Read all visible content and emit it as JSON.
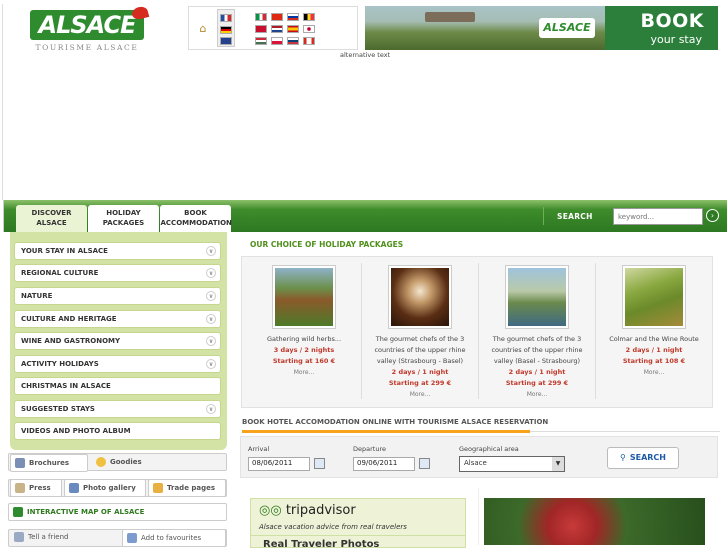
{
  "logo": {
    "brand": "ALSACE",
    "tagline": "TOURISME ALSACE"
  },
  "banner": {
    "alt": "alternative text",
    "chip": "ALSACE",
    "book": "BOOK",
    "sub": "your stay"
  },
  "tabs": [
    {
      "label": "DISCOVER ALSACE"
    },
    {
      "label": "HOLIDAY PACKAGES"
    },
    {
      "label": "BOOK ACCOMMODATION"
    }
  ],
  "search": {
    "label": "SEARCH",
    "placeholder": "keyword..."
  },
  "menu": [
    {
      "label": "YOUR STAY IN ALSACE"
    },
    {
      "label": "REGIONAL CULTURE"
    },
    {
      "label": "NATURE"
    },
    {
      "label": "CULTURE AND HERITAGE"
    },
    {
      "label": "WINE AND GASTRONOMY"
    },
    {
      "label": "ACTIVITY HOLIDAYS"
    },
    {
      "label": "CHRISTMAS IN ALSACE"
    },
    {
      "label": "SUGGESTED STAYS"
    },
    {
      "label": "VIDEOS AND PHOTO ALBUM"
    }
  ],
  "quicklinks": {
    "brochures": "Brochures",
    "goodies": "Goodies",
    "press": "Press",
    "gallery": "Photo gallery",
    "trade": "Trade pages",
    "map": "INTERACTIVE MAP OF ALSACE",
    "friend": "Tell a friend",
    "fav": "Add to favourites"
  },
  "packages": {
    "title": "OUR CHOICE OF HOLIDAY PACKAGES",
    "items": [
      {
        "name": "Gathering wild herbs...",
        "duration": "3 days / 2 nights",
        "price": "Starting at 160 €",
        "more": "More..."
      },
      {
        "name": "The gourmet chefs of the 3 countries of the upper rhine valley (Strasbourg - Basel)",
        "duration": "2 days / 1 night",
        "price": "Starting at 299 €",
        "more": "More..."
      },
      {
        "name": "The gourmet chefs of the 3 countries of the upper rhine valley (Basel - Strasbourg)",
        "duration": "2 days / 1 night",
        "price": "Starting at 299 €",
        "more": "More..."
      },
      {
        "name": "Colmar and the Wine Route",
        "duration": "2 days / 1 night",
        "price": "Starting at 108 €",
        "more": "More..."
      }
    ]
  },
  "booking": {
    "title": "BOOK HOTEL ACCOMODATION ONLINE WITH TOURISME ALSACE RESERVATION",
    "arrival_label": "Arrival",
    "arrival_value": "08/06/2011",
    "departure_label": "Departure",
    "departure_value": "09/06/2011",
    "geo_label": "Geographical area",
    "geo_value": "Alsace",
    "search_label": "SEARCH"
  },
  "tripadvisor": {
    "logo": "tripadvisor",
    "sub": "Alsace vacation advice from real travelers",
    "next": "Real Traveler Photos"
  }
}
